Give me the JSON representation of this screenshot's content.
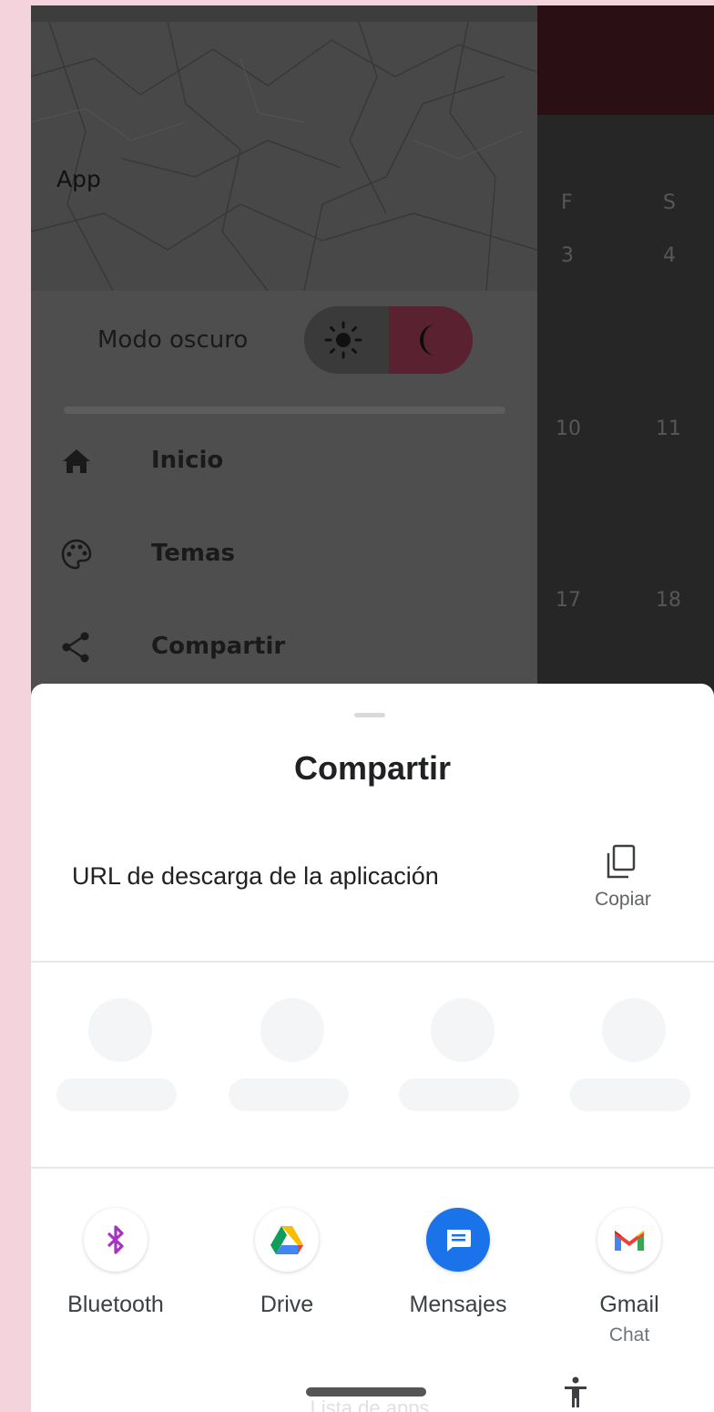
{
  "drawer": {
    "app_title": "App",
    "dark_mode_label": "Modo oscuro",
    "toggle": {
      "light_icon": "sun-icon",
      "dark_icon": "moon-icon",
      "selected": "dark"
    },
    "menu": [
      {
        "label": "Inicio",
        "icon": "home-icon"
      },
      {
        "label": "Temas",
        "icon": "palette-icon"
      },
      {
        "label": "Compartir",
        "icon": "share-icon"
      }
    ]
  },
  "calendar_bg": {
    "weekdays": [
      "F",
      "S"
    ],
    "rows": [
      [
        "3",
        "4"
      ],
      [
        "10",
        "11"
      ],
      [
        "17",
        "18"
      ]
    ]
  },
  "share_sheet": {
    "title": "Compartir",
    "share_text": "URL de descarga de la aplicación",
    "copy_label": "Copiar",
    "apps": [
      {
        "label": "Bluetooth",
        "sublabel": "",
        "icon": "bluetooth-icon"
      },
      {
        "label": "Drive",
        "sublabel": "",
        "icon": "google-drive-icon"
      },
      {
        "label": "Mensajes",
        "sublabel": "",
        "icon": "messages-icon"
      },
      {
        "label": "Gmail",
        "sublabel": "Chat",
        "icon": "gmail-icon"
      }
    ],
    "apps_list_label": "Lista de apps"
  },
  "colors": {
    "drawer_bg": "#4e4e4e",
    "toggle_dark_bg": "#5a2130",
    "sheet_bg": "#ffffff",
    "outer_bg": "#f5d3dc"
  }
}
